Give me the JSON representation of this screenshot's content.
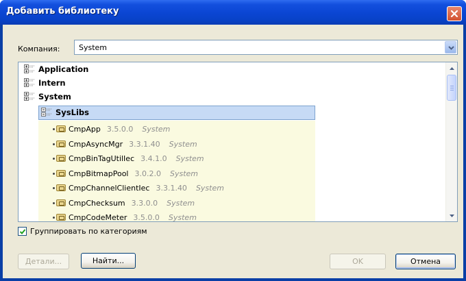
{
  "window": {
    "title": "Добавить библиотеку",
    "close_icon": "close-x-icon"
  },
  "company": {
    "label": "Компания:",
    "value": "System"
  },
  "tree": {
    "categories": [
      {
        "label": "Application",
        "expanded": false
      },
      {
        "label": "Intern",
        "expanded": false
      },
      {
        "label": "System",
        "expanded": true
      }
    ],
    "selected_category": {
      "label": "SysLibs",
      "expanded": true
    },
    "libraries": [
      {
        "name": "CmpApp",
        "version": "3.5.0.0",
        "vendor": "System"
      },
      {
        "name": "CmpAsyncMgr",
        "version": "3.3.1.40",
        "vendor": "System"
      },
      {
        "name": "CmpBinTagUtilIec",
        "version": "3.4.1.0",
        "vendor": "System"
      },
      {
        "name": "CmpBitmapPool",
        "version": "3.0.2.0",
        "vendor": "System"
      },
      {
        "name": "CmpChannelClientIec",
        "version": "3.3.1.40",
        "vendor": "System"
      },
      {
        "name": "CmpChecksum",
        "version": "3.3.0.0",
        "vendor": "System"
      },
      {
        "name": "CmpCodeMeter",
        "version": "3.5.0.0",
        "vendor": "System"
      }
    ]
  },
  "group_by_category": {
    "label": "Группировать по категориям",
    "checked": true
  },
  "buttons": {
    "details": "Детали...",
    "find": "Найти...",
    "ok": "OK",
    "cancel": "Отмена"
  },
  "colors": {
    "title_bar": "#0b46d4",
    "dialog_bg": "#ece9d8",
    "selection": "#c6daf5",
    "library_panel": "#fafae0",
    "version_text": "#8f8f8f"
  }
}
